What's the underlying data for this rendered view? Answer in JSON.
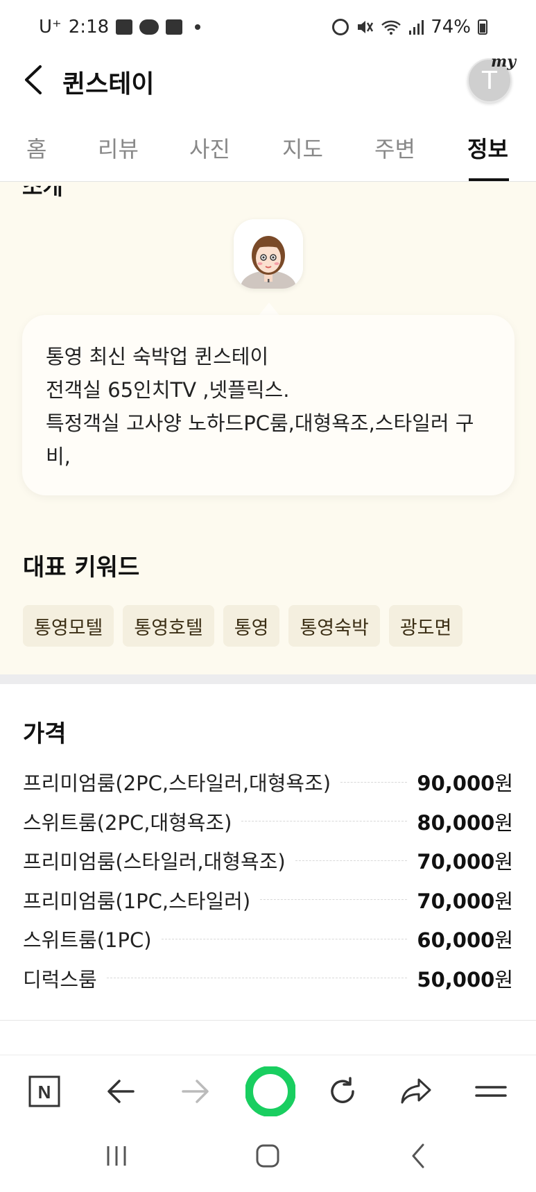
{
  "status_bar": {
    "carrier": "U⁺",
    "time": "2:18",
    "battery": "74%"
  },
  "header": {
    "title": "퀸스테이",
    "avatar_initial": "T",
    "avatar_badge": "my"
  },
  "tabs": [
    {
      "label": "홈",
      "active": false
    },
    {
      "label": "리뷰",
      "active": false
    },
    {
      "label": "사진",
      "active": false
    },
    {
      "label": "지도",
      "active": false
    },
    {
      "label": "주변",
      "active": false
    },
    {
      "label": "정보",
      "active": true
    }
  ],
  "intro": {
    "cut_heading": "소개",
    "lines": [
      "통영 최신 숙박업 퀸스테이",
      "전객실 65인치TV ,넷플릭스.",
      "특정객실 고사양 노하드PC룸,대형욕조,스타일러 구",
      "비,"
    ]
  },
  "keywords": {
    "title": "대표 키워드",
    "items": [
      "통영모텔",
      "통영호텔",
      "통영",
      "통영숙박",
      "광도면"
    ]
  },
  "prices": {
    "title": "가격",
    "currency_unit": "원",
    "items": [
      {
        "name": "프리미엄룸(2PC,스타일러,대형욕조)",
        "price": "90,000"
      },
      {
        "name": "스위트룸(2PC,대형욕조)",
        "price": "80,000"
      },
      {
        "name": "프리미엄룸(스타일러,대형욕조)",
        "price": "70,000"
      },
      {
        "name": "프리미엄룸(1PC,스타일러)",
        "price": "70,000"
      },
      {
        "name": "스위트룸(1PC)",
        "price": "60,000"
      },
      {
        "name": "디럭스룸",
        "price": "50,000"
      }
    ]
  },
  "toolbar": {
    "n_logo": "N",
    "icons": [
      "naver-home-icon",
      "back-arrow-icon",
      "forward-arrow-icon",
      "green-dot-icon",
      "refresh-icon",
      "share-icon",
      "menu-icon"
    ]
  },
  "colors": {
    "intro_bg": "#fdfaef",
    "keyword_bg": "#f4efdf",
    "green_accent": "#19ce60"
  }
}
